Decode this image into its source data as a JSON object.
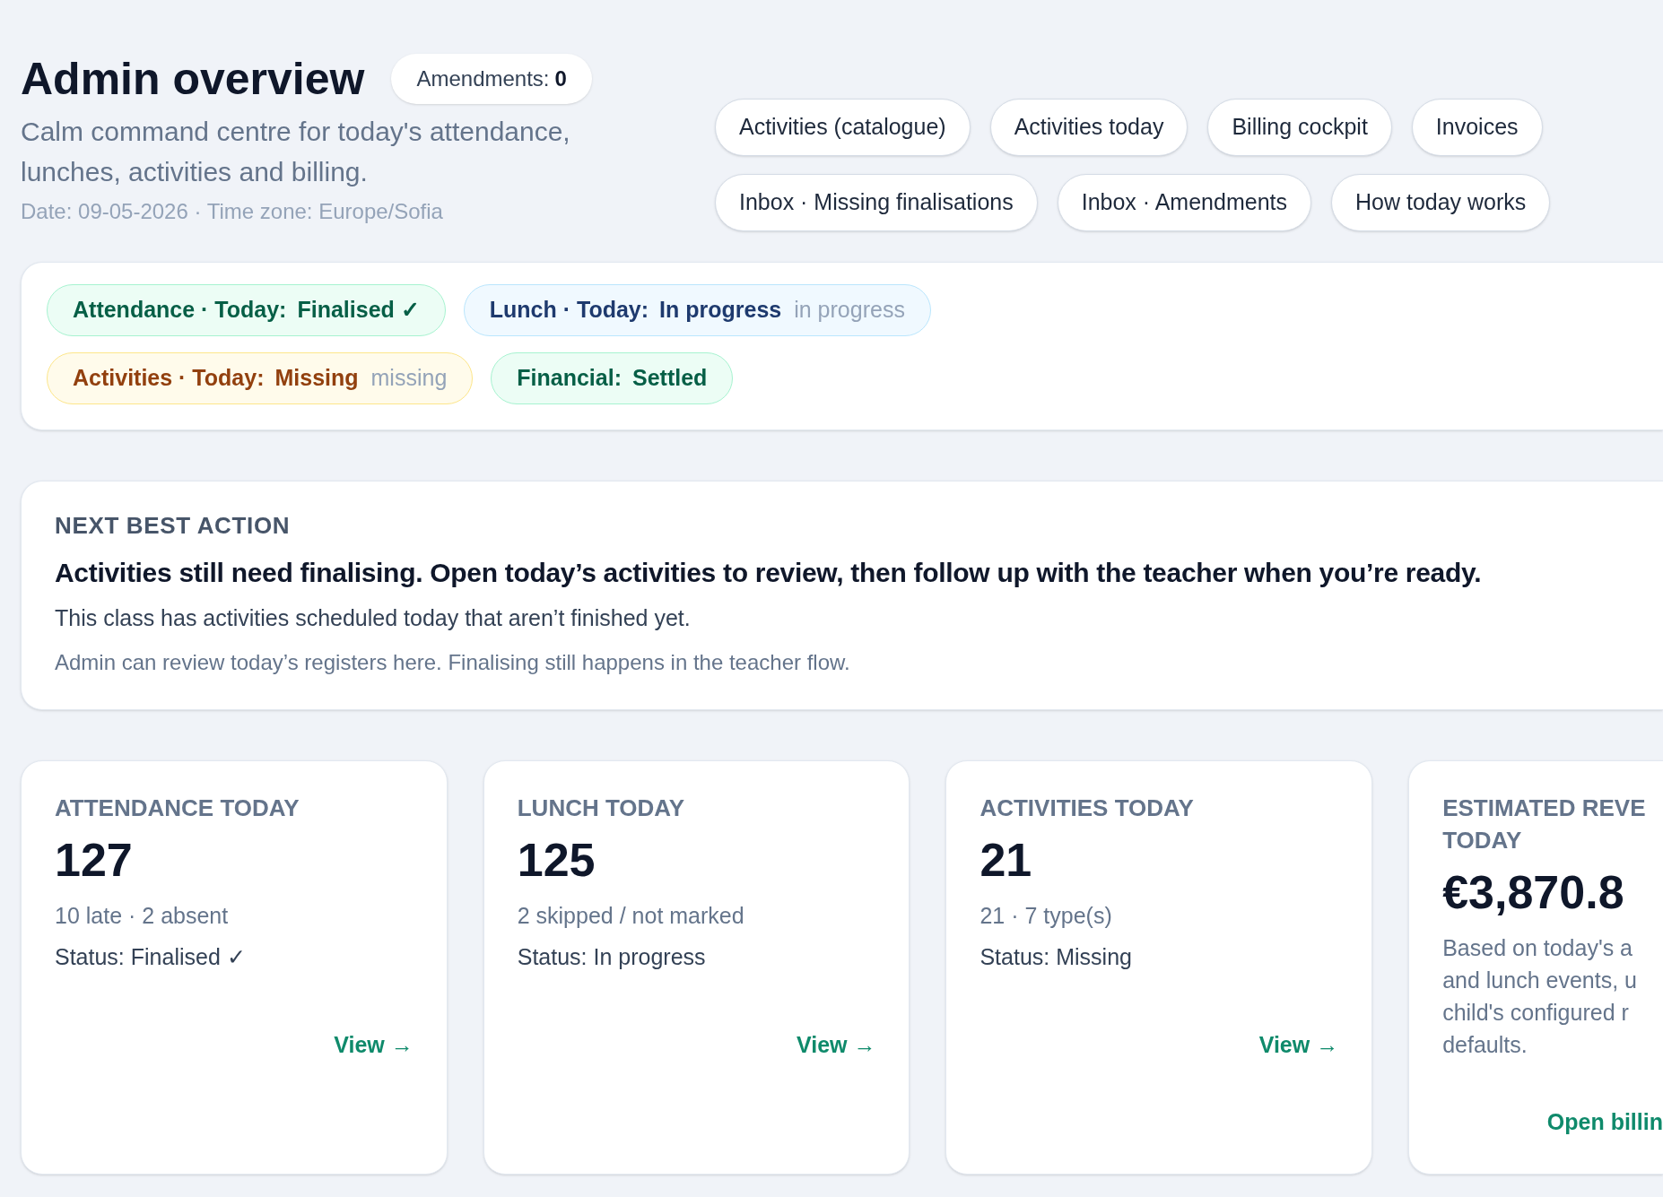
{
  "header": {
    "title": "Admin overview",
    "badge_label": "Amendments:",
    "badge_value": "0",
    "subtitle": "Calm command centre for today's attendance, lunches, activities and billing.",
    "meta": "Date: 09-05-2026 · Time zone: Europe/Sofia"
  },
  "nav_rows": [
    [
      "Activities (catalogue)",
      "Activities today",
      "Billing cockpit",
      "Invoices"
    ],
    [
      "Inbox · Missing finalisations",
      "Inbox · Amendments",
      "How today works"
    ]
  ],
  "status_pills": [
    {
      "kind": "success",
      "label": "Attendance · Today:",
      "value": "Finalised ✓"
    },
    {
      "kind": "info",
      "label": "Lunch · Today:",
      "value": "In progress",
      "note": "in progress"
    },
    {
      "kind": "warning",
      "label": "Activities · Today:",
      "value": "Missing",
      "note": "missing"
    },
    {
      "kind": "success",
      "label": "Financial:",
      "value": "Settled"
    }
  ],
  "next_action": {
    "label": "NEXT BEST ACTION",
    "headline": "Activities still need finalising. Open today’s activities to review, then follow up with the teacher when you’re ready.",
    "detail": "This class has activities scheduled today that aren’t finished yet.",
    "note": "Admin can review today’s registers here. Finalising still happens in the teacher flow."
  },
  "metrics": [
    {
      "title": "ATTENDANCE TODAY",
      "value": "127",
      "sub": "10 late · 2 absent",
      "status": "Status: Finalised ✓",
      "link": "View →"
    },
    {
      "title": "LUNCH TODAY",
      "value": "125",
      "sub": "2 skipped / not marked",
      "status": "Status: In progress",
      "link": "View →"
    },
    {
      "title": "ACTIVITIES TODAY",
      "value": "21",
      "sub": "21 · 7 type(s)",
      "status": "Status: Missing",
      "link": "View →"
    },
    {
      "title": "ESTIMATED REVE\nTODAY",
      "value": "€3,870.8",
      "sub": "Based on today's a\nand lunch events, u\nchild's configured r\ndefaults.",
      "link": "Open billin"
    }
  ]
}
